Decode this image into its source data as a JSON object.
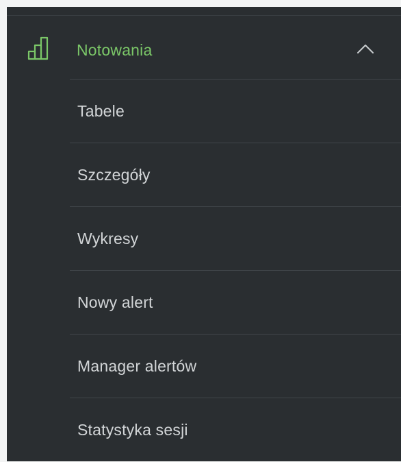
{
  "menu": {
    "section": {
      "title": "Notowania",
      "icon": "bar-chart-icon",
      "expanded_icon": "chevron-up-icon",
      "accent_color": "#7bc768"
    },
    "items": [
      {
        "label": "Tabele"
      },
      {
        "label": "Szczegóły"
      },
      {
        "label": "Wykresy"
      },
      {
        "label": "Nowy alert"
      },
      {
        "label": "Manager alertów"
      },
      {
        "label": "Statystyka sesji"
      }
    ]
  }
}
